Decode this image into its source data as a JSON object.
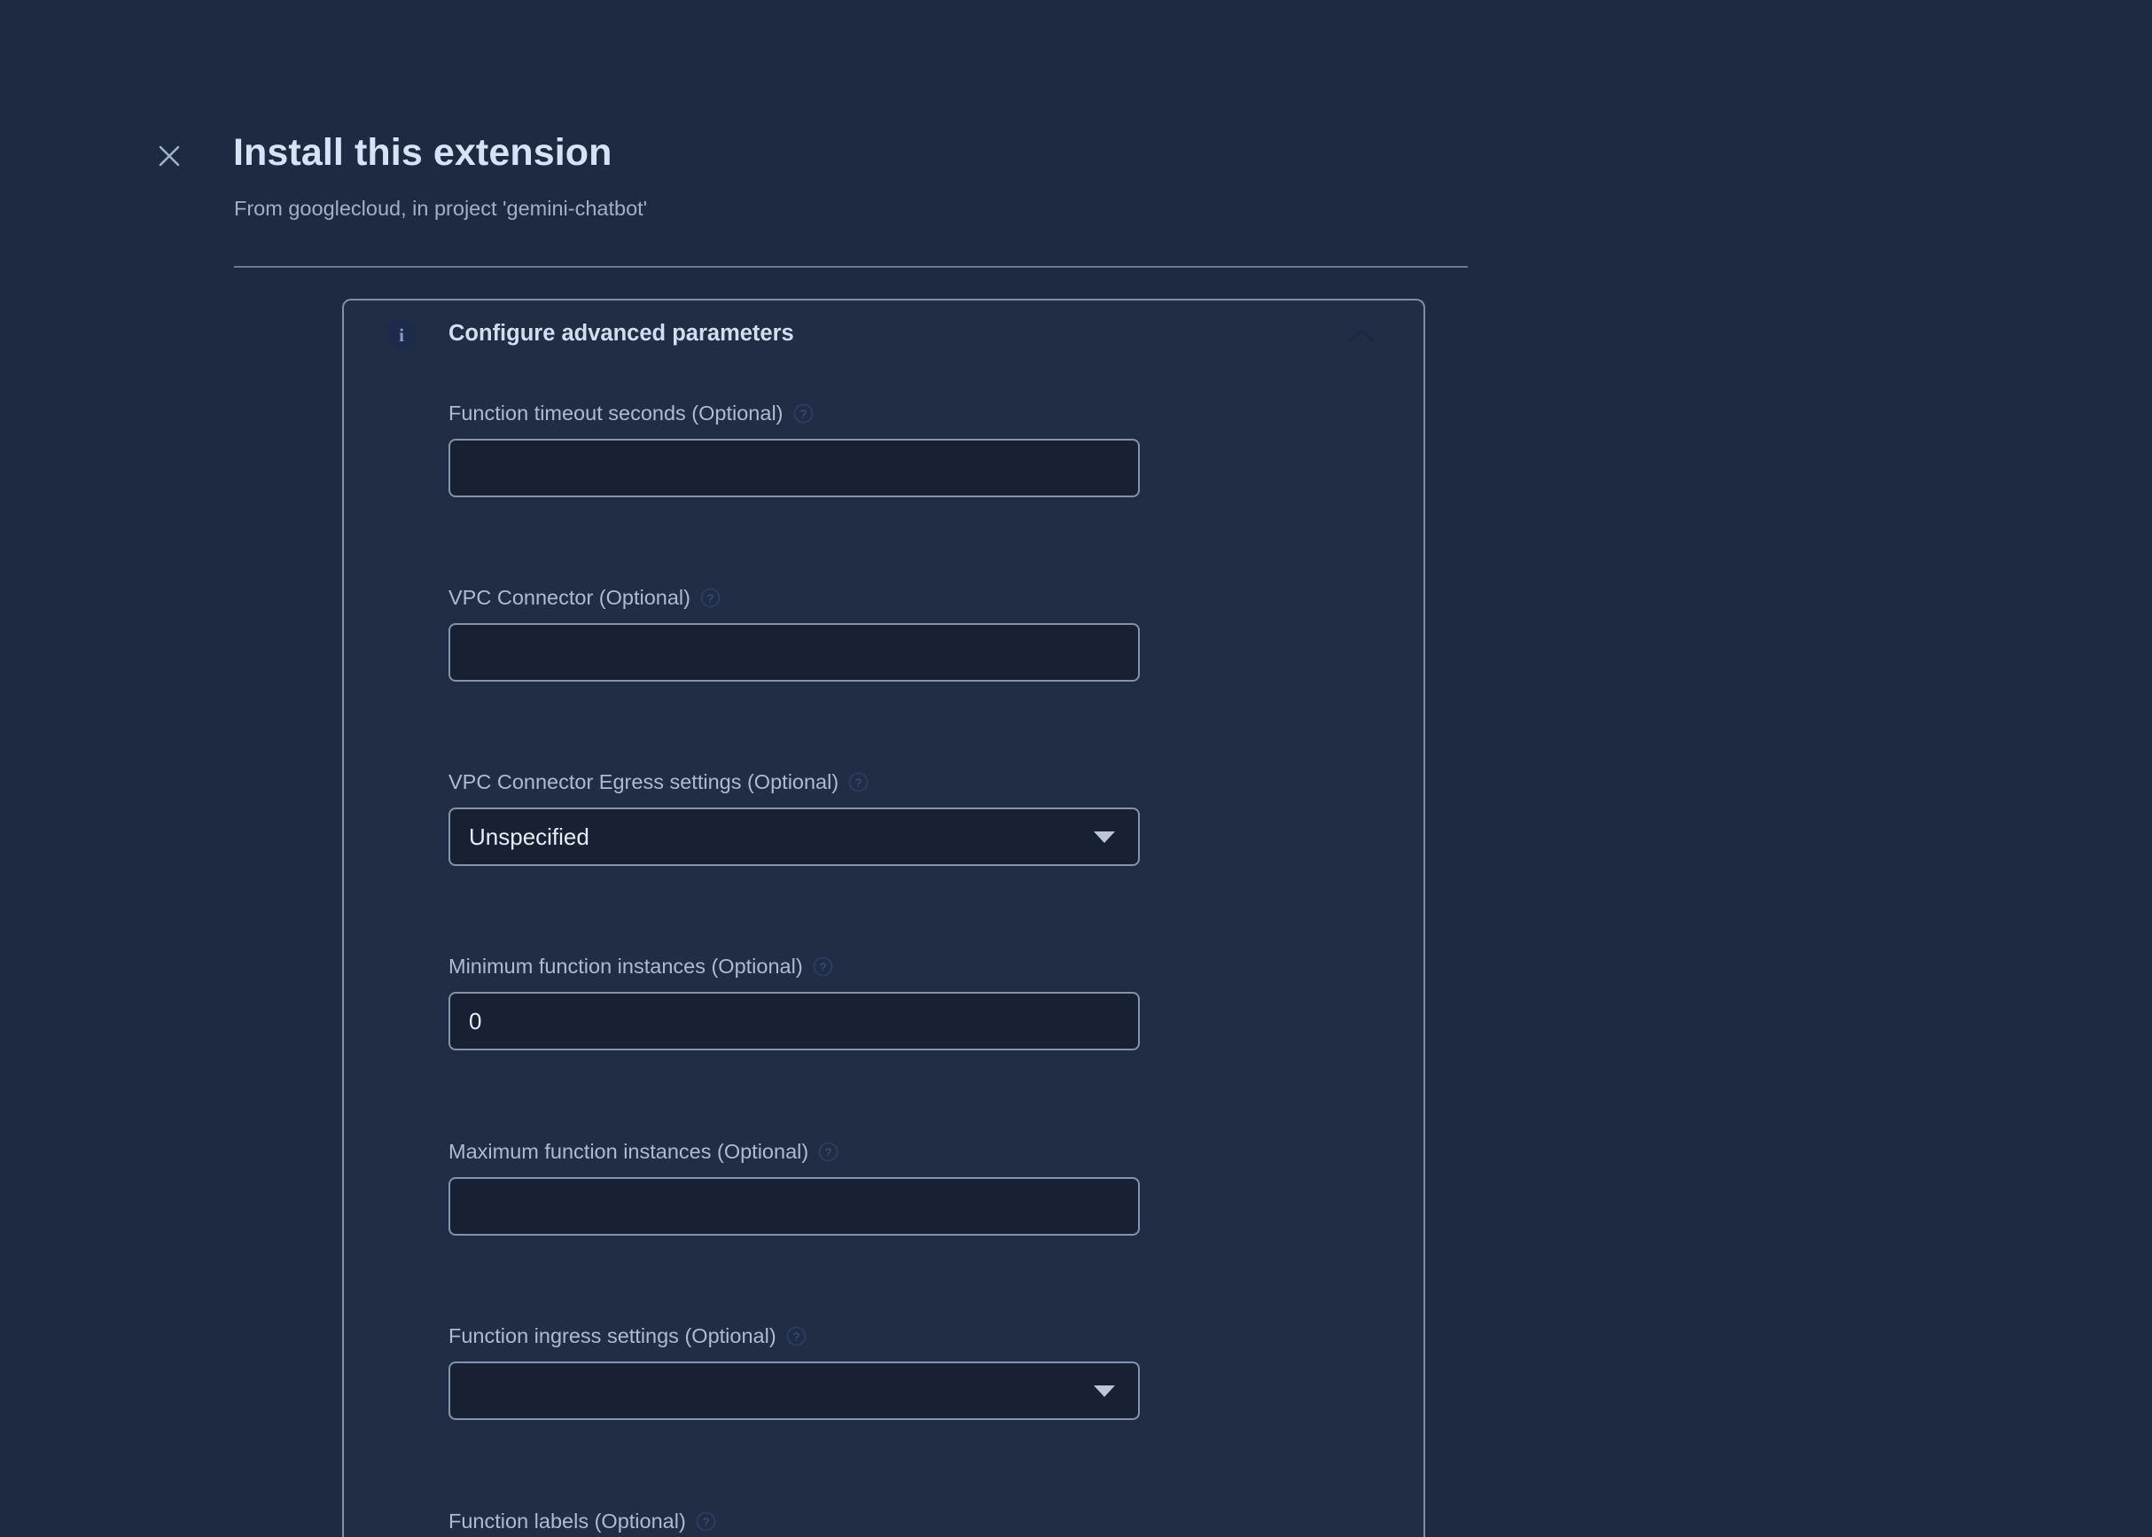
{
  "header": {
    "close_icon": "close-icon",
    "title": "Install this extension",
    "subtitle": "From googlecloud, in project 'gemini-chatbot'"
  },
  "card": {
    "info_icon": "info-icon",
    "info_glyph": "i",
    "title": "Configure advanced parameters",
    "collapse_icon": "chevron-up-icon",
    "fields": [
      {
        "label": "Function timeout seconds (Optional)",
        "help_icon": "help-circle-icon",
        "type": "text",
        "value": "",
        "placeholder": ""
      },
      {
        "label": "VPC Connector (Optional)",
        "help_icon": "help-circle-icon",
        "type": "text",
        "value": "",
        "placeholder": ""
      },
      {
        "label": "VPC Connector Egress settings (Optional)",
        "help_icon": "help-circle-icon",
        "type": "select",
        "value": "Unspecified",
        "placeholder": ""
      },
      {
        "label": "Minimum function instances (Optional)",
        "help_icon": "help-circle-icon",
        "type": "text",
        "value": "0",
        "placeholder": ""
      },
      {
        "label": "Maximum function instances (Optional)",
        "help_icon": "help-circle-icon",
        "type": "text",
        "value": "",
        "placeholder": ""
      },
      {
        "label": "Function ingress settings (Optional)",
        "help_icon": "help-circle-icon",
        "type": "select",
        "value": "",
        "placeholder": ""
      },
      {
        "label": "Function labels (Optional)",
        "help_icon": "help-circle-icon",
        "type": "text",
        "value": "",
        "placeholder": ""
      }
    ]
  },
  "colors": {
    "page_background": "#1e2a42",
    "card_background": "#202d45",
    "input_background": "#172133",
    "border": "#8393ad",
    "title_text": "#d6e2f5",
    "label_text": "#adbbd2",
    "subtitle_text": "#9fb0c9",
    "value_text": "#e6edf8",
    "info_icon_background": "#1d2a4b"
  }
}
